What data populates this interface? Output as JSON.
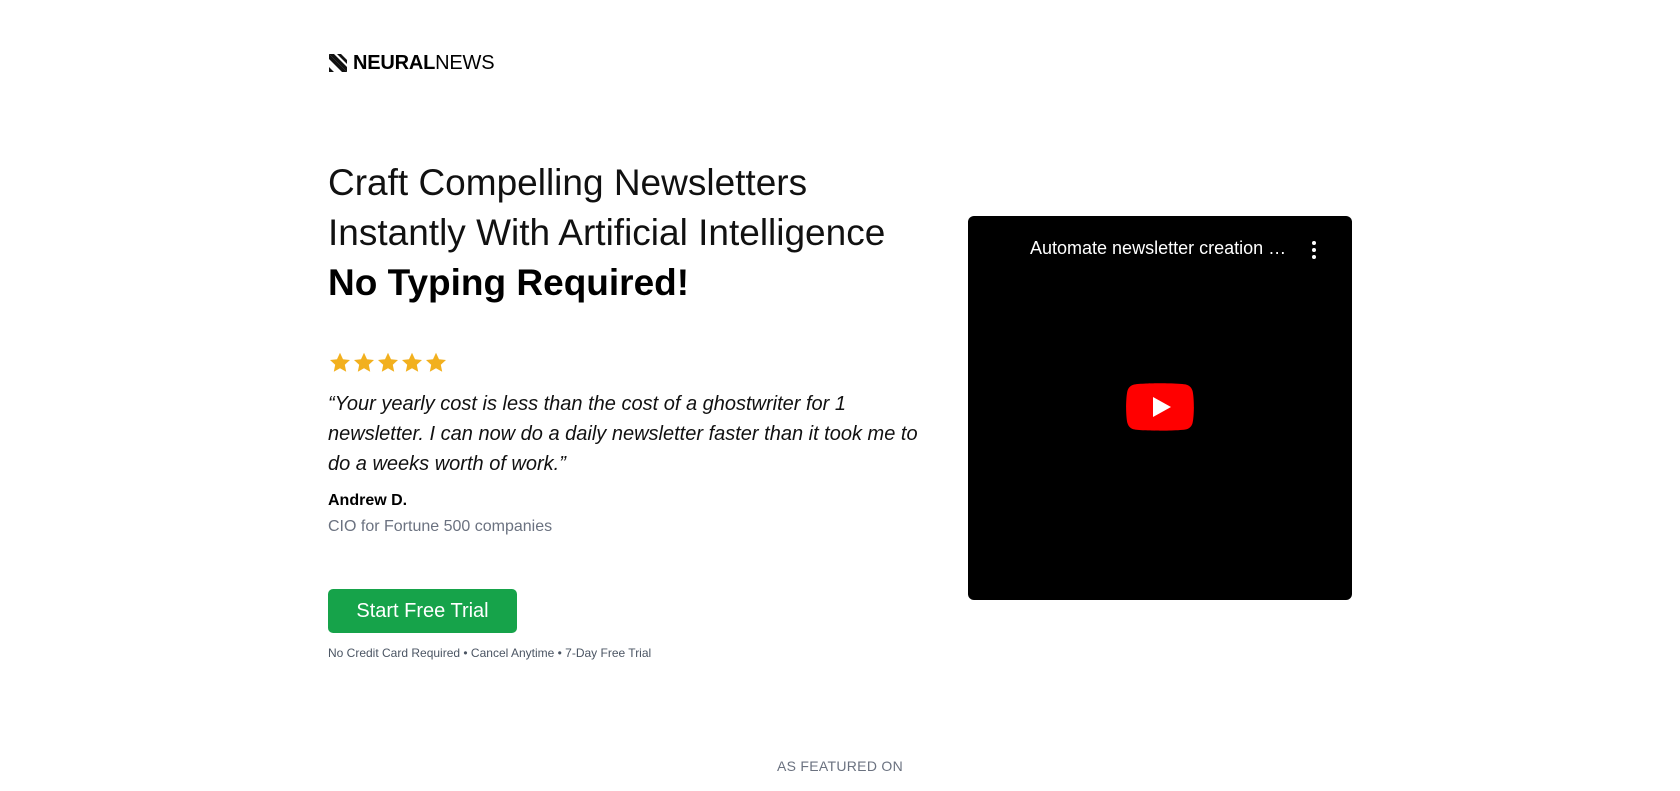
{
  "brand": {
    "name_bold": "NEURAL",
    "name_light": "NEWS",
    "icon": "neuralnews-logo-icon"
  },
  "hero": {
    "headline_line1": "Craft Compelling Newsletters",
    "headline_line2": "Instantly With Artificial Intelligence",
    "headline_line3": "No Typing Required!"
  },
  "testimonial": {
    "rating": 5,
    "rating_max": 5,
    "star_color": "#F2B01E",
    "quote": "“Your yearly cost is less than the cost of a ghostwriter for 1 newsletter. I can now do a daily newsletter faster than it took me to do a weeks worth of work.”",
    "author_name": "Andrew D.",
    "author_title": "CIO for Fortune 500 companies"
  },
  "cta": {
    "label": "Start Free Trial",
    "color": "#16A34A",
    "note": "No Credit Card Required • Cancel Anytime • 7-Day Free Trial"
  },
  "video": {
    "title": "Automate newsletter creation with AI",
    "play_icon": "youtube-play-icon",
    "menu_icon": "more-vertical-icon",
    "play_color": "#FF0000"
  },
  "featured": {
    "label": "AS FEATURED ON"
  }
}
